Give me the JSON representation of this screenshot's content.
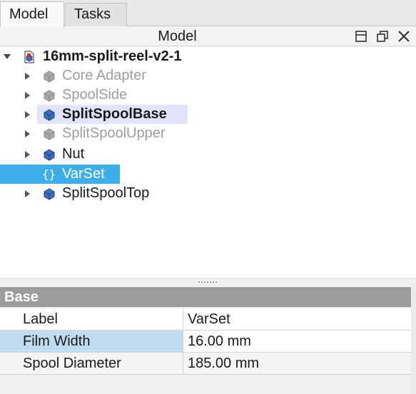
{
  "tabs": [
    {
      "label": "Model",
      "active": true
    },
    {
      "label": "Tasks",
      "active": false
    }
  ],
  "panel": {
    "title": "Model",
    "buttons": [
      "float-panel-icon",
      "undock-icon",
      "close-icon"
    ]
  },
  "tree": {
    "root": {
      "label": "16mm-split-reel-v2-1",
      "icon": "document-icon",
      "expanded": true
    },
    "items": [
      {
        "label": "Core Adapter",
        "icon": "part-icon",
        "visible": false
      },
      {
        "label": "SpoolSide",
        "icon": "part-icon",
        "visible": false
      },
      {
        "label": "SplitSpoolBase",
        "icon": "part-icon",
        "visible": true,
        "bold": true,
        "highlighted": true
      },
      {
        "label": "SplitSpoolUpper",
        "icon": "part-icon",
        "visible": false
      },
      {
        "label": "Nut",
        "icon": "part-icon",
        "visible": true
      },
      {
        "label": "VarSet",
        "icon": "varset-icon",
        "visible": true,
        "selected": true
      },
      {
        "label": "SplitSpoolTop",
        "icon": "part-icon",
        "visible": true
      }
    ]
  },
  "properties": {
    "group": "Base",
    "rows": [
      {
        "name": "Label",
        "value": "VarSet"
      },
      {
        "name": "Film Width",
        "value": "16.00 mm",
        "selected": true
      },
      {
        "name": "Spool Diameter",
        "value": "185.00 mm"
      }
    ]
  },
  "colors": {
    "selection": "#3daee9",
    "highlight": "#e1e4fb",
    "group_header": "#9c9c9c",
    "part_icon": "#3c6fbf",
    "hidden_text": "#9d9d9d"
  }
}
